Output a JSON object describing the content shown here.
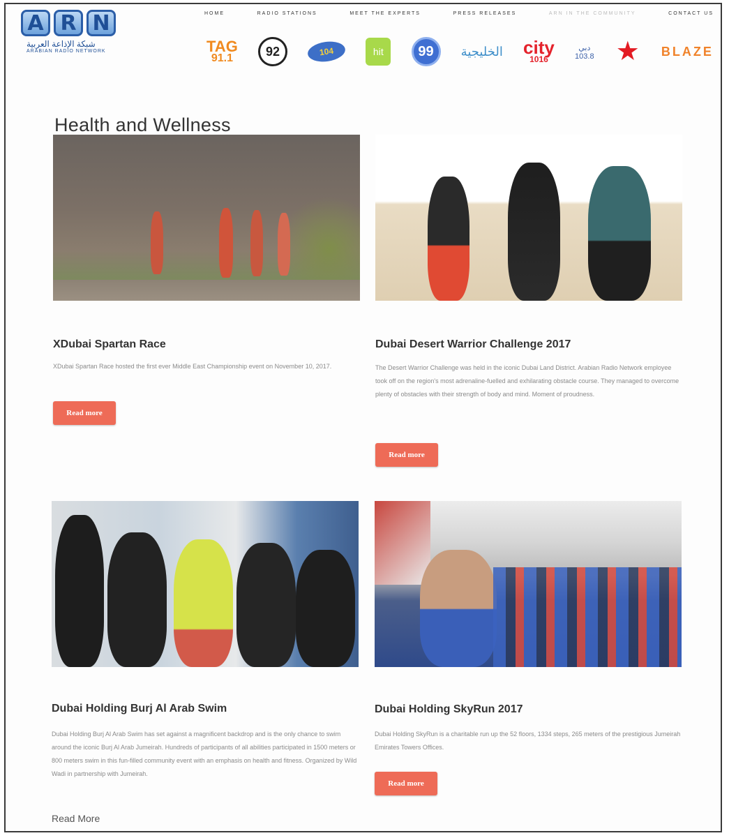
{
  "logo": {
    "letters": [
      "A",
      "R",
      "N"
    ],
    "arabic": "شبكة الإذاعة العربية",
    "english": "ARABIAN RADIO NETWORK"
  },
  "nav": {
    "items": [
      {
        "label": "HOME"
      },
      {
        "label": "RADIO STATIONS"
      },
      {
        "label": "MEET THE EXPERTS"
      },
      {
        "label": "PRESS RELEASES"
      },
      {
        "label": "ARN IN THE COMMUNITY"
      },
      {
        "label": "CONTACT US"
      }
    ]
  },
  "stations": {
    "tag_a": "TAG",
    "tag_b": "91.1",
    "s92": "92",
    "s104": "104",
    "hit": "hit",
    "s99": "99",
    "khaleejia": "الخليجية",
    "city_a": "city",
    "city_b": "1016",
    "dubai": "دبي",
    "dubai_b": "103.8",
    "virgin": "★",
    "blaze": "BLAZE"
  },
  "page": {
    "title": "Health and Wellness"
  },
  "cards": [
    {
      "title": "XDubai Spartan Race",
      "desc": "XDubai Spartan Race hosted the first ever Middle East Championship event on November 10, 2017.",
      "button": "Read more"
    },
    {
      "title": "Dubai Desert Warrior Challenge 2017",
      "desc": "The Desert Warrior Challenge was held in the iconic Dubai Land District. Arabian Radio Network employee took off on the region's most adrenaline-fuelled and exhilarating obstacle course. They managed to overcome plenty of obstacles with their strength of body and mind. Moment of proudness.",
      "button": "Read more"
    },
    {
      "title": "Dubai Holding Burj Al Arab Swim",
      "desc": "Dubai Holding Burj Al Arab Swim has set against a magnificent backdrop and is the only chance to swim around the iconic Burj Al Arab Jumeirah. Hundreds of participants of all abilities participated in 1500 meters or 800 meters swim in this fun-filled community event with an emphasis on health and fitness. Organized by Wild Wadi in partnership with Jumeirah.",
      "link": "Read More"
    },
    {
      "title": "Dubai Holding SkyRun 2017",
      "desc": "Dubai Holding SkyRun is a charitable run up the 52 floors, 1334 steps, 265 meters of the prestigious Jumeirah Emirates Towers Offices.",
      "button": "Read more"
    }
  ],
  "colors": {
    "accent": "#ee6b57",
    "brand": "#2b5ea8"
  }
}
